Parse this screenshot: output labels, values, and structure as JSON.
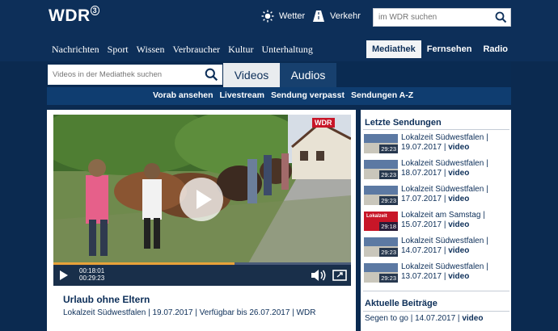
{
  "header": {
    "logo": "WDR",
    "logo_mark": "3",
    "weather_label": "Wetter",
    "traffic_label": "Verkehr",
    "search_placeholder": "im WDR suchen"
  },
  "main_nav": [
    "Nachrichten",
    "Sport",
    "Wissen",
    "Verbraucher",
    "Kultur",
    "Unterhaltung"
  ],
  "right_nav": {
    "mediathek": "Mediathek",
    "fernsehen": "Fernsehen",
    "radio": "Radio"
  },
  "mediathek": {
    "search_placeholder": "Videos in der Mediathek suchen",
    "tab_videos": "Videos",
    "tab_audios": "Audios",
    "sub_links": [
      "Vorab ansehen",
      "Livestream",
      "Sendung verpasst",
      "Sendungen A-Z"
    ]
  },
  "player": {
    "current_time": "00:18:01",
    "total_time": "00:29:23",
    "progress_fraction": 0.61,
    "video_badge": "WDR"
  },
  "video": {
    "title": "Urlaub ohne Eltern",
    "meta": "Lokalzeit Südwestfalen | 19.07.2017 | Verfügbar bis 26.07.2017 | WDR"
  },
  "sidebar": {
    "heading": "Letzte Sendungen",
    "items": [
      {
        "show": "Lokalzeit Südwestfalen |",
        "date": "19.07.2017",
        "type": "video",
        "duration": "29:23",
        "thumb": "street"
      },
      {
        "show": "Lokalzeit Südwestfalen |",
        "date": "18.07.2017",
        "type": "video",
        "duration": "29:23",
        "thumb": "street"
      },
      {
        "show": "Lokalzeit Südwestfalen |",
        "date": "17.07.2017",
        "type": "video",
        "duration": "29:23",
        "thumb": "street"
      },
      {
        "show": "Lokalzeit am Samstag |",
        "date": "15.07.2017",
        "type": "video",
        "duration": "29:18",
        "thumb": "red",
        "thumb_label": "Lokalzeit"
      },
      {
        "show": "Lokalzeit Südwestfalen |",
        "date": "14.07.2017",
        "type": "video",
        "duration": "29:23",
        "thumb": "street"
      },
      {
        "show": "Lokalzeit Südwestfalen |",
        "date": "13.07.2017",
        "type": "video",
        "duration": "29:23",
        "thumb": "street"
      }
    ],
    "heading2": "Aktuelle Beiträge",
    "last_item": {
      "show": "Segen to go |",
      "date": "14.07.2017",
      "type": "video"
    }
  },
  "colors": {
    "header_bg": "#0d2f59",
    "accent_progress": "#e8a23a",
    "thumb_red": "#c81628"
  }
}
